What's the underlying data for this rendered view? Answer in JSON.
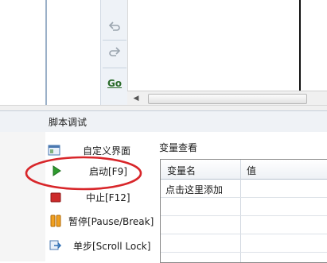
{
  "toolbar": {
    "buttons": [
      {
        "icon": "undo-arrow-icon"
      },
      {
        "icon": "redo-arrow-icon"
      },
      {
        "icon": "go-icon",
        "label": "Go"
      }
    ]
  },
  "panel": {
    "title": "脚本调试"
  },
  "debug_commands": [
    {
      "label": "自定义界面",
      "icon": "custom-ui-icon"
    },
    {
      "label": "启动[F9]",
      "icon": "play-icon",
      "highlighted": true
    },
    {
      "label": "中止[F12]",
      "icon": "stop-icon"
    },
    {
      "label": "暂停[Pause/Break]",
      "icon": "pause-icon"
    },
    {
      "label": "单步[Scroll Lock]",
      "icon": "step-icon"
    }
  ],
  "watch": {
    "title": "变量查看",
    "columns": [
      "变量名",
      "值"
    ],
    "rows": [
      {
        "name": "点击这里添加",
        "value": ""
      }
    ]
  },
  "colors": {
    "annotation": "#d8262a",
    "play": "#2e9b2e",
    "stop": "#cc2a2a",
    "pause": "#e08a10"
  }
}
